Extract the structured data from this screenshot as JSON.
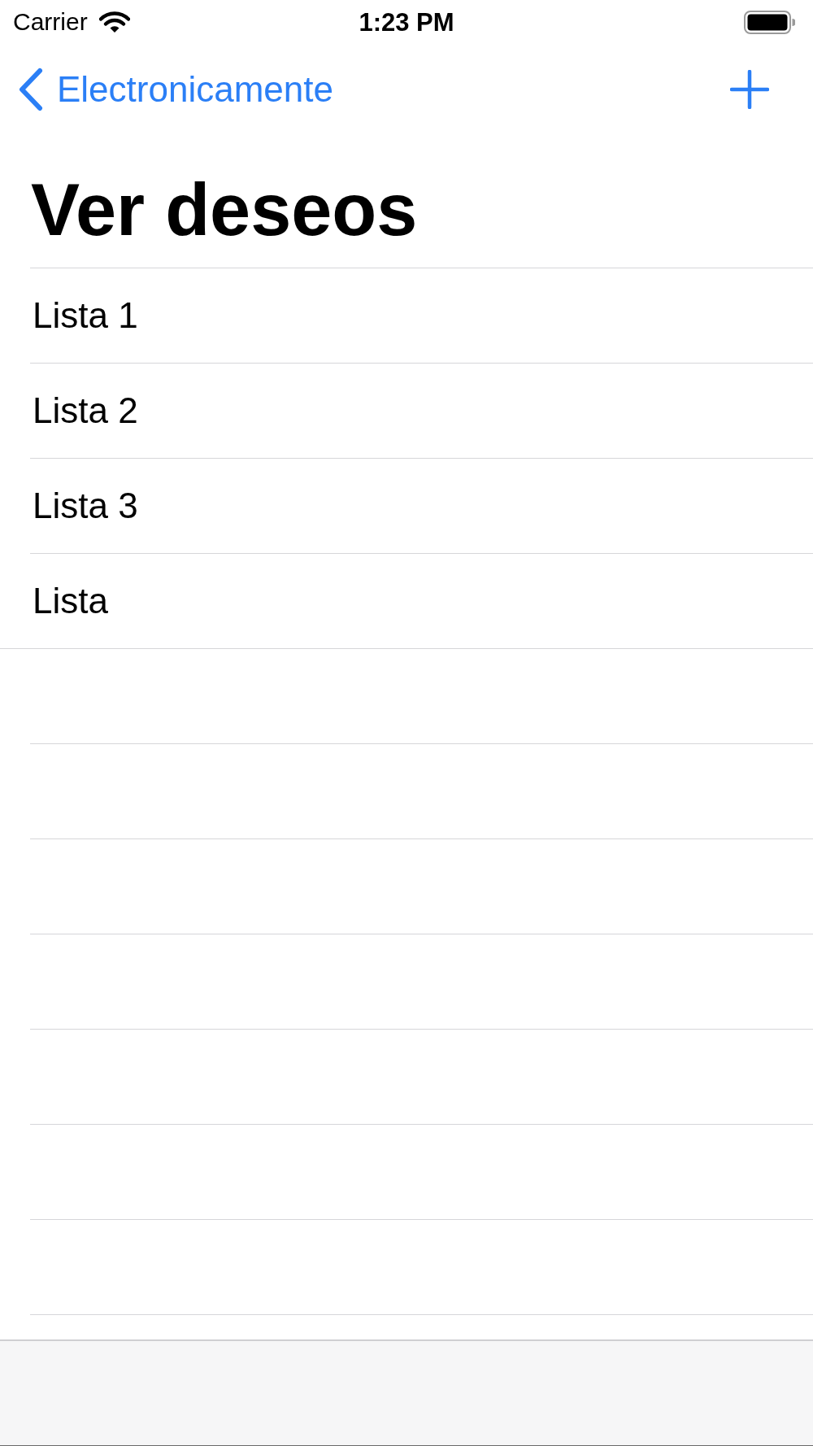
{
  "status_bar": {
    "carrier": "Carrier",
    "time": "1:23 PM"
  },
  "nav_bar": {
    "back_label": "Electronicamente"
  },
  "title": "Ver deseos",
  "rows": [
    {
      "label": "Lista 1"
    },
    {
      "label": "Lista 2"
    },
    {
      "label": "Lista 3"
    },
    {
      "label": "Lista"
    }
  ]
}
